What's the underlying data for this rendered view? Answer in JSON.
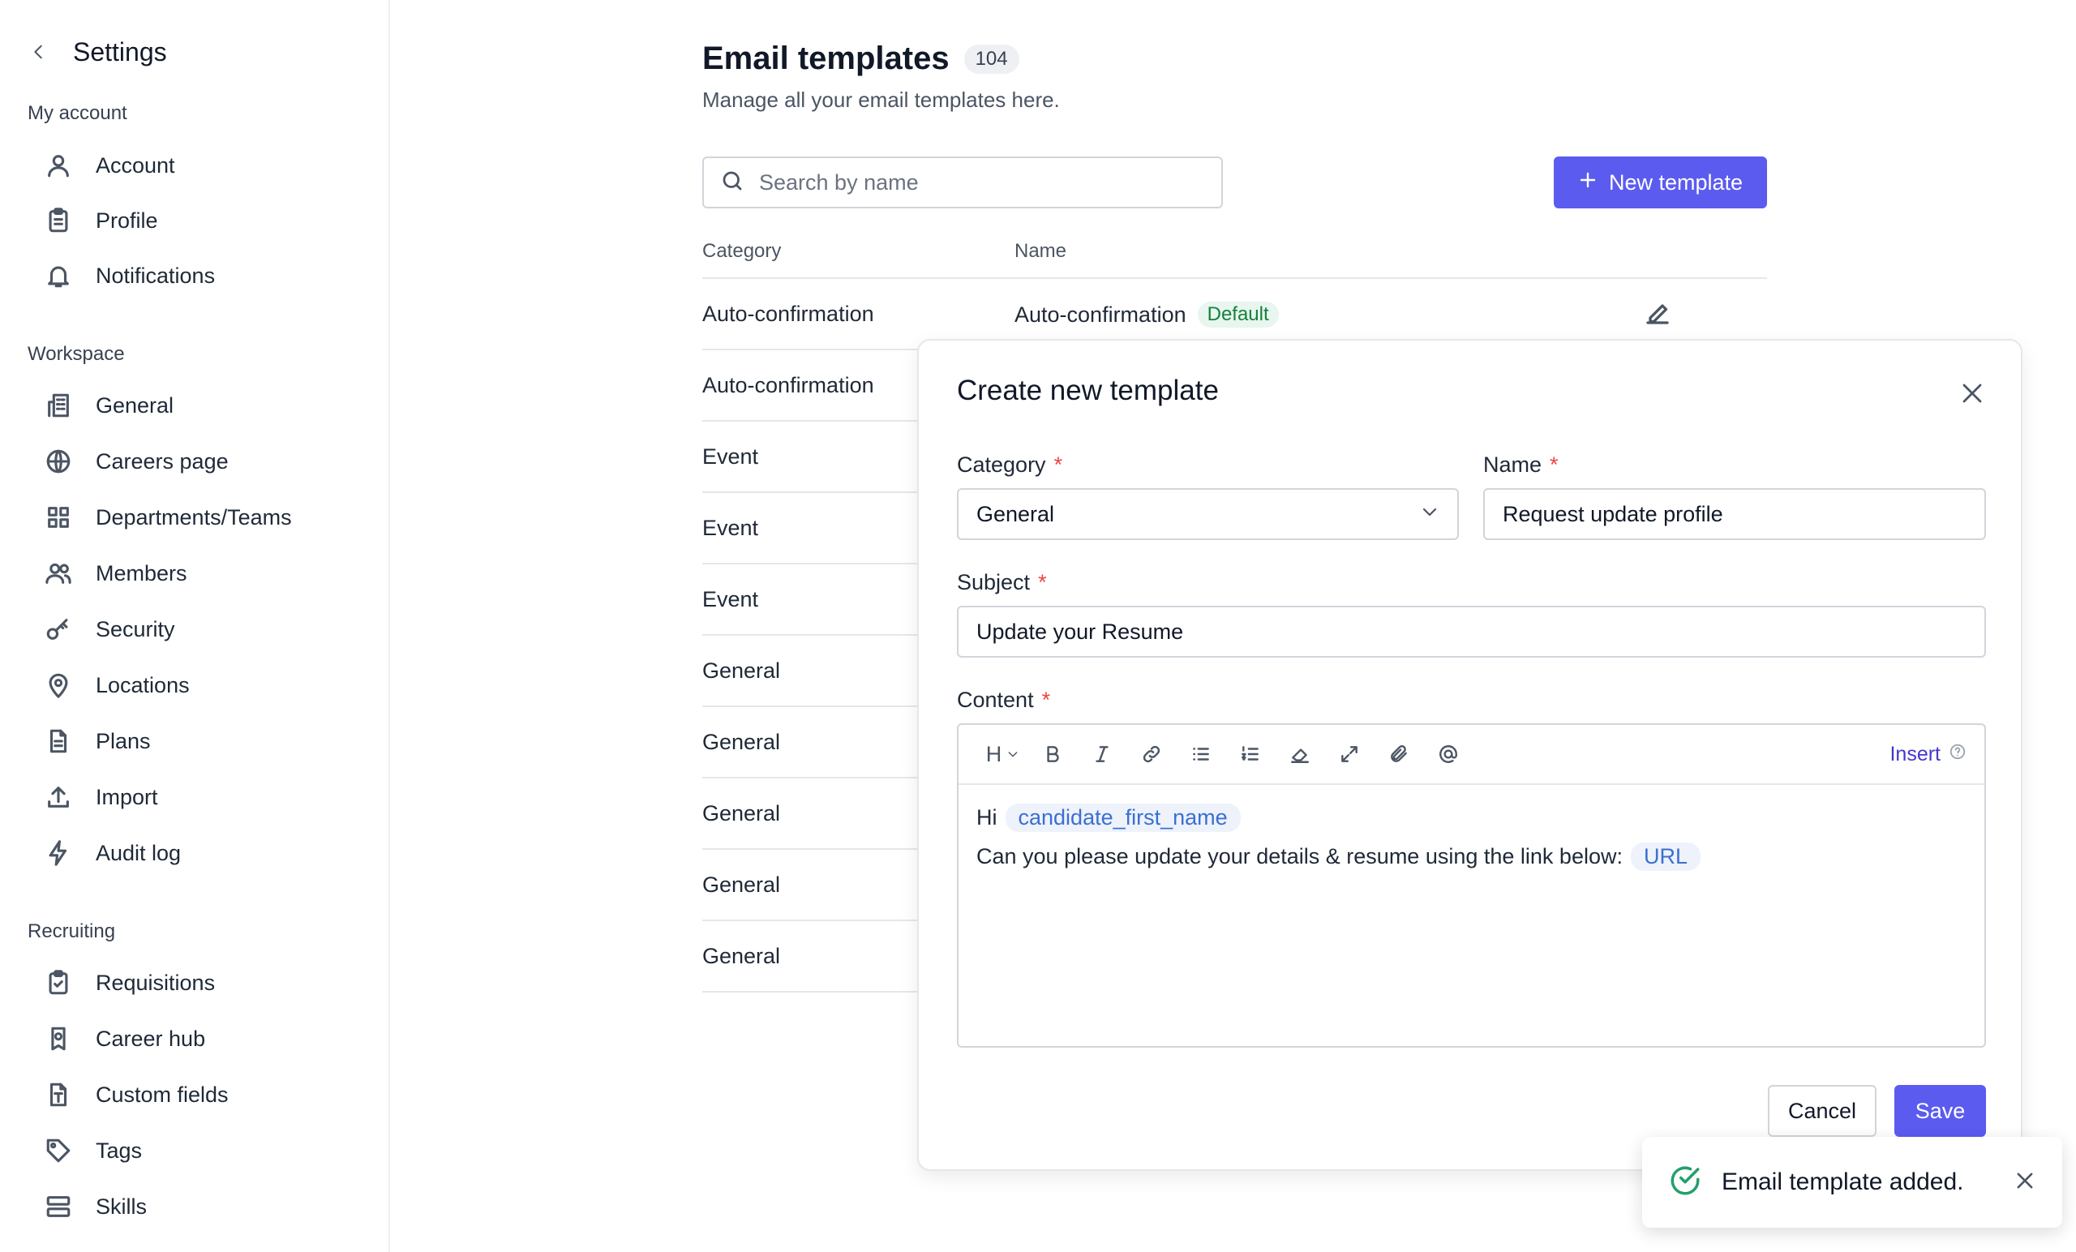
{
  "sidebar": {
    "title": "Settings",
    "sections": [
      {
        "label": "My account"
      },
      {
        "label": "Workspace"
      },
      {
        "label": "Recruiting"
      }
    ],
    "items": [
      {
        "label": "Account",
        "icon": "user-icon"
      },
      {
        "label": "Profile",
        "icon": "clipboard-icon"
      },
      {
        "label": "Notifications",
        "icon": "bell-icon"
      },
      {
        "label": "General",
        "icon": "building-icon"
      },
      {
        "label": "Careers page",
        "icon": "globe-icon"
      },
      {
        "label": "Departments/Teams",
        "icon": "grid-icon"
      },
      {
        "label": "Members",
        "icon": "users-icon"
      },
      {
        "label": "Security",
        "icon": "key-icon"
      },
      {
        "label": "Locations",
        "icon": "map-pin-icon"
      },
      {
        "label": "Plans",
        "icon": "document-icon"
      },
      {
        "label": "Import",
        "icon": "upload-icon"
      },
      {
        "label": "Audit log",
        "icon": "lightning-icon"
      },
      {
        "label": "Requisitions",
        "icon": "clipboard-check-icon"
      },
      {
        "label": "Career hub",
        "icon": "badge-icon"
      },
      {
        "label": "Custom fields",
        "icon": "text-file-icon"
      },
      {
        "label": "Tags",
        "icon": "tag-icon"
      },
      {
        "label": "Skills",
        "icon": "server-icon"
      }
    ]
  },
  "main": {
    "title": "Email templates",
    "count": "104",
    "subtitle": "Manage all your email templates here.",
    "search_placeholder": "Search by name",
    "new_button": "New template",
    "columns": [
      "Category",
      "Name"
    ],
    "rows": [
      {
        "category": "Auto-confirmation",
        "name": "Auto-confirmation",
        "badge": "Default"
      },
      {
        "category": "Auto-confirmation",
        "name": ""
      },
      {
        "category": "Event",
        "name": ""
      },
      {
        "category": "Event",
        "name": ""
      },
      {
        "category": "Event",
        "name": ""
      },
      {
        "category": "General",
        "name": ""
      },
      {
        "category": "General",
        "name": ""
      },
      {
        "category": "General",
        "name": ""
      },
      {
        "category": "General",
        "name": ""
      },
      {
        "category": "General",
        "name": ""
      }
    ]
  },
  "modal": {
    "title": "Create new template",
    "category_label": "Category",
    "category_value": "General",
    "name_label": "Name",
    "name_value": "Request update profile",
    "subject_label": "Subject",
    "subject_value": "Update your Resume",
    "content_label": "Content",
    "required_mark": "*",
    "toolbar": {
      "heading": "H",
      "insert_label": "Insert"
    },
    "content": {
      "line1_text": "Hi",
      "line1_token": "candidate_first_name",
      "line2_text": "Can you please update your details & resume using the link below:",
      "line2_token": "URL"
    },
    "cancel_label": "Cancel",
    "save_label": "Save"
  },
  "toast": {
    "message": "Email template added."
  },
  "colors": {
    "accent": "#5b5bf0",
    "success": "#22a06b",
    "required": "#ef4444",
    "token_text": "#3b6fd1"
  }
}
